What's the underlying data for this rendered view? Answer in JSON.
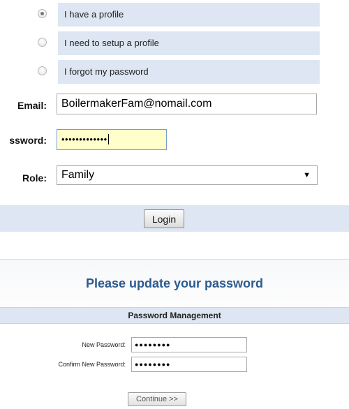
{
  "login": {
    "options": [
      {
        "label": "I have a profile",
        "checked": true
      },
      {
        "label": "I need to setup a profile",
        "checked": false
      },
      {
        "label": "I forgot my password",
        "checked": false
      }
    ],
    "email_label": "Email:",
    "email_value": "BoilermakerFam@nomail.com",
    "password_label": "ssword:",
    "password_mask": "•••••••••••••",
    "role_label": "Role:",
    "role_value": "Family",
    "login_button": "Login"
  },
  "password_update": {
    "title": "Please update your password",
    "section_header": "Password Management",
    "new_password_label": "New Password:",
    "new_password_mask": "●●●●●●●●",
    "confirm_password_label": "Confirm New Password:",
    "confirm_password_mask": "●●●●●●●●",
    "continue_button": "Continue >>"
  },
  "colors": {
    "row_bg": "#dde6f2",
    "title_blue": "#2c5a8e",
    "focus_bg": "#ffffcc"
  }
}
